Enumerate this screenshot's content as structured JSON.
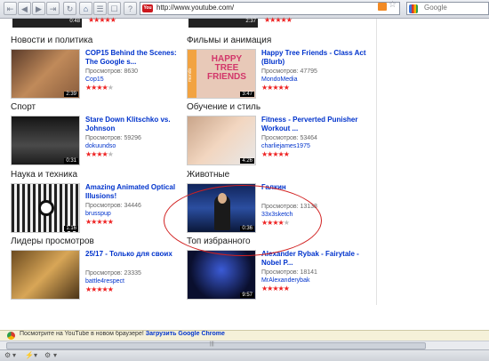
{
  "browser": {
    "url": "http://www.youtube.com/",
    "favicon_text": "You",
    "search_placeholder": "Google"
  },
  "sections": [
    {
      "title": "Новости и политика",
      "video": {
        "title": "COP15 Behind the Scenes: The Google s...",
        "views": "Просмотров: 8630",
        "author": "Cop15",
        "duration": "2:39",
        "rating": 4
      }
    },
    {
      "title": "Фильмы и анимация",
      "video": {
        "title": "Happy Tree Friends - Class Act (Blurb)",
        "views": "Просмотров: 47795",
        "author": "MondoMedia",
        "duration": "3:47",
        "rating": 5,
        "thumb_text": "HAPPY TREE FRIENDS",
        "thumb_brand": "mondo"
      }
    },
    {
      "title": "Спорт",
      "video": {
        "title": "Stare Down Klitschko vs. Johnson",
        "views": "Просмотров: 59296",
        "author": "dokuundso",
        "duration": "0:31",
        "rating": 4
      }
    },
    {
      "title": "Обучение и стиль",
      "video": {
        "title": "Fitness - Perverted Punisher Workout ...",
        "views": "Просмотров: 53464",
        "author": "charliejames1975",
        "duration": "4:26",
        "rating": 5
      }
    },
    {
      "title": "Наука и техника",
      "video": {
        "title": "Amazing Animated Optical Illusions!",
        "views": "Просмотров: 34446",
        "author": "brusspup",
        "duration": "1:16",
        "rating": 5
      }
    },
    {
      "title": "Животные",
      "video": {
        "title": "Галкин",
        "views": "Просмотров: 13138",
        "author": "33x3sketch",
        "duration": "0:36",
        "rating": 4
      }
    },
    {
      "title": "Лидеры просмотров",
      "video": {
        "title": "25/17 - Только для своих",
        "views": "Просмотров: 23335",
        "author": "battle4respect",
        "duration": "",
        "rating": 5
      }
    },
    {
      "title": "Топ избранного",
      "video": {
        "title": "Alexander Rybak - Fairytale - Nobel P...",
        "views": "Просмотров: 18141",
        "author": "MrAlexanderybak",
        "duration": "9:57",
        "rating": 5
      }
    }
  ],
  "top_durations": [
    "0:48",
    "2:37"
  ],
  "notice": {
    "text": "Посмотрите на YouTube в новом браузере!",
    "link": "Загрузить Google Chrome"
  },
  "colors": {
    "link": "#0033cc",
    "star": "#e22222",
    "annotation_circle": "#d12020"
  }
}
